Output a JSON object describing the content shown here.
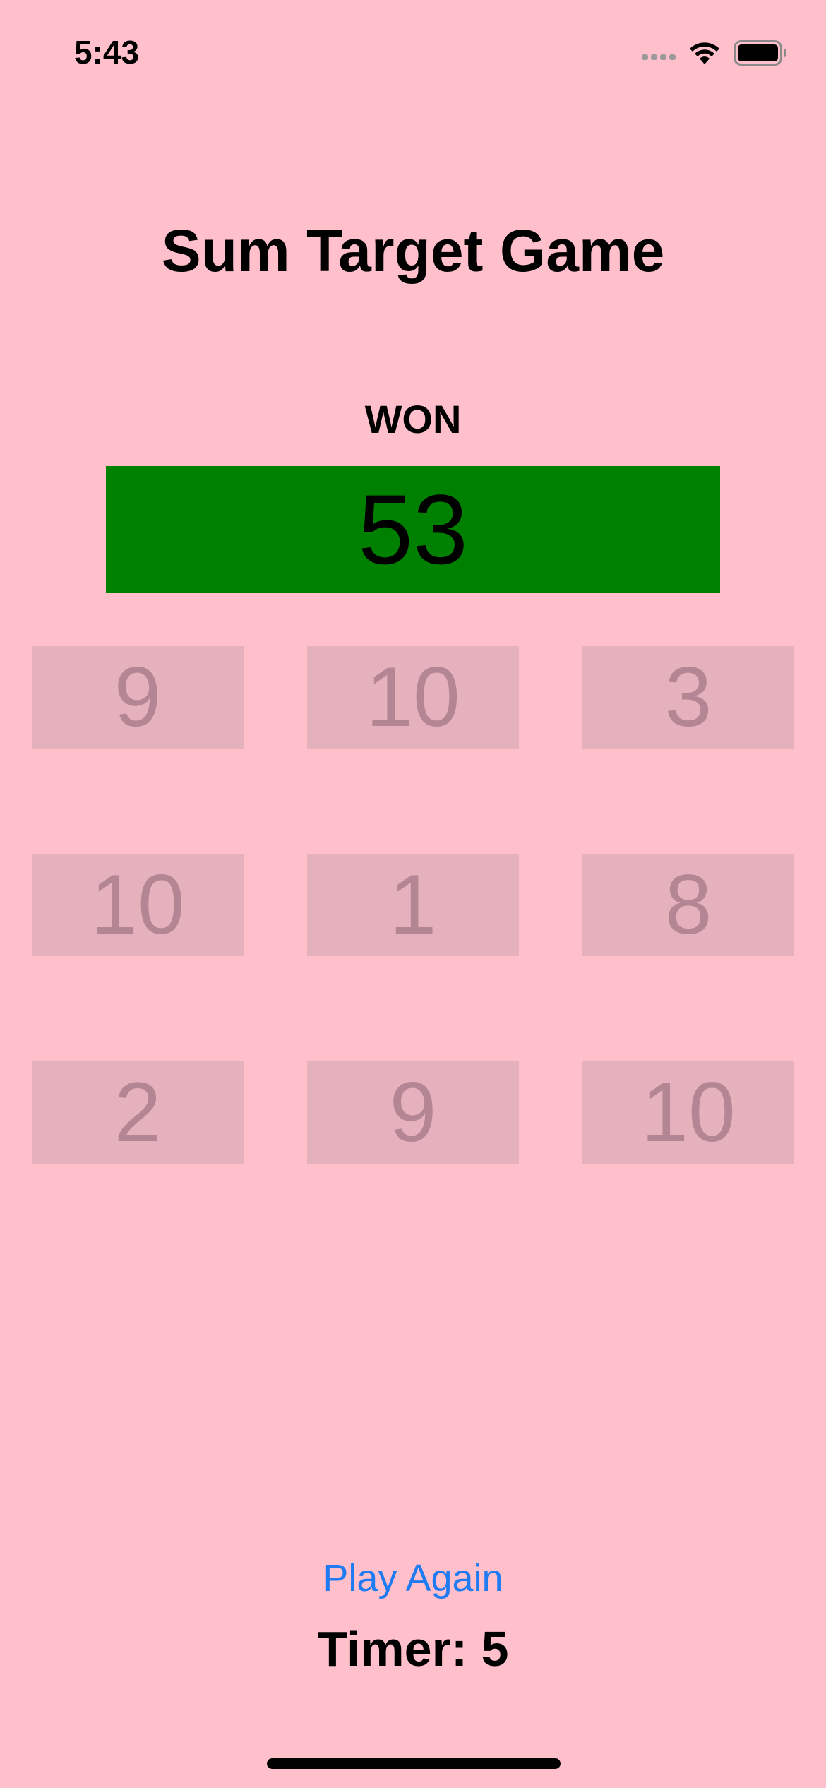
{
  "status_bar": {
    "time": "5:43",
    "signal_icon": "cellular-signal-icon",
    "wifi_icon": "wifi-icon",
    "battery_icon": "battery-icon"
  },
  "game": {
    "title": "Sum Target Game",
    "status": "WON",
    "target": "53",
    "target_color": "#008000",
    "numbers": [
      "9",
      "10",
      "3",
      "10",
      "1",
      "8",
      "2",
      "9",
      "10"
    ],
    "play_again_label": "Play Again",
    "timer_text": "Timer: 5"
  },
  "colors": {
    "background": "#FFC0CB",
    "link": "#1E7BF2"
  }
}
